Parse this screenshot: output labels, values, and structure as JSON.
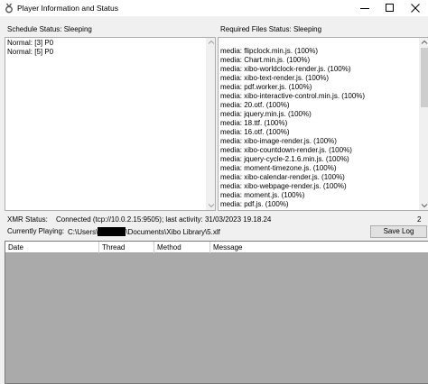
{
  "window": {
    "title": "Player Information and Status",
    "icon": "xibo-app-icon",
    "controls": [
      "minimize-icon",
      "maximize-icon",
      "close-icon"
    ]
  },
  "schedule": {
    "label": "Schedule Status:",
    "status": "Sleeping",
    "items": [
      "Normal: [3]  P0",
      "Normal: [5]  P0"
    ]
  },
  "required_files": {
    "label": "Required Files Status:",
    "status": "Sleeping",
    "items": [
      "media: flipclock.min.js. (100%)",
      "media: Chart.min.js. (100%)",
      "media: xibo-worldclock-render.js. (100%)",
      "media: xibo-text-render.js. (100%)",
      "media: pdf.worker.js. (100%)",
      "media: xibo-interactive-control.min.js. (100%)",
      "media: 20.otf. (100%)",
      "media: jquery.min.js. (100%)",
      "media: 18.ttf. (100%)",
      "media: 16.otf. (100%)",
      "media: xibo-image-render.js. (100%)",
      "media: xibo-countdown-render.js. (100%)",
      "media: jquery-cycle-2.1.6.min.js. (100%)",
      "media: moment-timezone.js. (100%)",
      "media: xibo-calendar-render.js. (100%)",
      "media: xibo-webpage-render.js. (100%)",
      "media: moment.js. (100%)",
      "media: pdf.js. (100%)",
      "media: xibo-layout-scaler.js. (100%)"
    ]
  },
  "xmr": {
    "label": "XMR Status:",
    "value": "Connected (tcp://10.0.2.15:9505); last activity: 31/03/2023 19.18.24",
    "count": "2"
  },
  "currently_playing": {
    "label": "Currently Playing:",
    "path_start": "C:\\Users\\",
    "path_end": "\\Documents\\Xibo Library\\5.xlf"
  },
  "save_log_label": "Save Log",
  "log_table": {
    "columns": [
      "Date",
      "Thread",
      "Method",
      "Message"
    ]
  }
}
